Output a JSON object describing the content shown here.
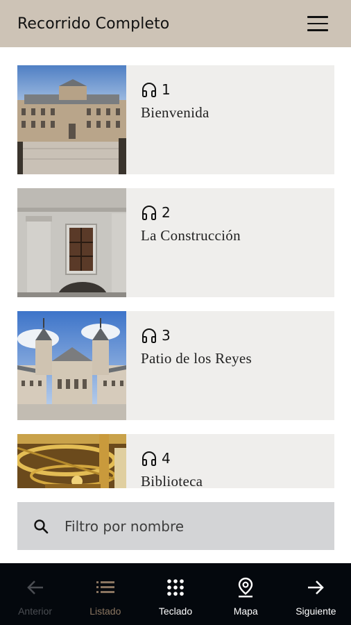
{
  "header": {
    "title": "Recorrido Completo",
    "menu_icon": "hamburger-icon"
  },
  "stops": [
    {
      "number": "1",
      "title": "Bienvenida",
      "icon": "headphones-icon"
    },
    {
      "number": "2",
      "title": "La Construcción",
      "icon": "headphones-icon"
    },
    {
      "number": "3",
      "title": "Patio de los Reyes",
      "icon": "headphones-icon"
    },
    {
      "number": "4",
      "title": "Biblioteca",
      "icon": "headphones-icon"
    }
  ],
  "search": {
    "placeholder": "Filtro por nombre",
    "value": "",
    "icon": "search-icon"
  },
  "bottom_nav": {
    "items": [
      {
        "label": "Anterior",
        "icon": "arrow-left-icon",
        "state": "disabled"
      },
      {
        "label": "Listado",
        "icon": "list-icon",
        "state": "active"
      },
      {
        "label": "Teclado",
        "icon": "keypad-icon",
        "state": "normal"
      },
      {
        "label": "Mapa",
        "icon": "map-pin-icon",
        "state": "normal"
      },
      {
        "label": "Siguiente",
        "icon": "arrow-right-icon",
        "state": "normal"
      }
    ]
  },
  "colors": {
    "header_bg": "#cdc3b6",
    "card_bg": "#efeeec",
    "search_bg": "#d3d4d6",
    "nav_bg": "#04080d",
    "nav_active": "#8a7560",
    "nav_disabled": "#4a4d52"
  }
}
